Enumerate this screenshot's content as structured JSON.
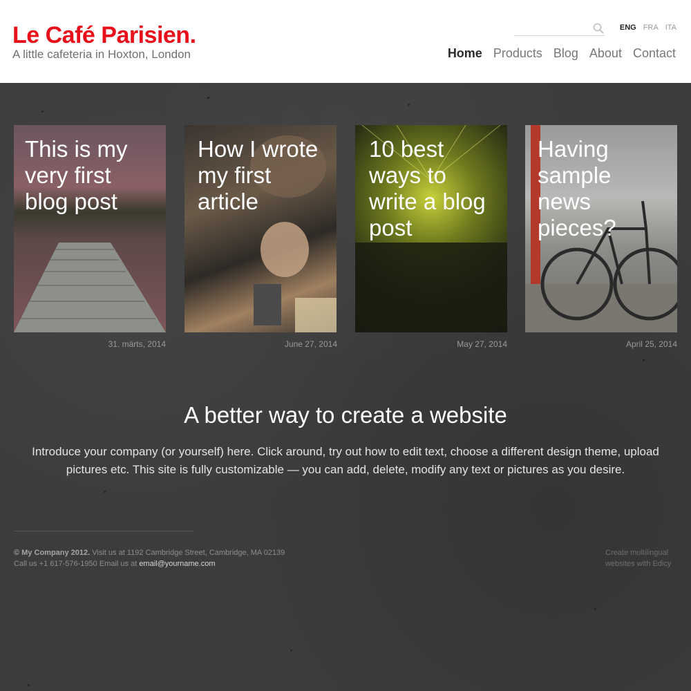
{
  "header": {
    "title": "Le Café Parisien.",
    "subtitle": "A little cafeteria in Hoxton, London",
    "search": {
      "placeholder": "",
      "value": ""
    },
    "languages": [
      {
        "label": "ENG",
        "active": true
      },
      {
        "label": "FRA",
        "active": false
      },
      {
        "label": "ITA",
        "active": false
      }
    ],
    "nav": [
      {
        "label": "Home",
        "active": true
      },
      {
        "label": "Products",
        "active": false
      },
      {
        "label": "Blog",
        "active": false
      },
      {
        "label": "About",
        "active": false
      },
      {
        "label": "Contact",
        "active": false
      }
    ]
  },
  "posts": [
    {
      "title": "This is my very first blog post",
      "date": "31. märts, 2014",
      "image": "lake-dock"
    },
    {
      "title": "How I wrote my first article",
      "date": "June 27, 2014",
      "image": "craftsman-tools"
    },
    {
      "title": "10 best ways to write a blog post",
      "date": "May 27, 2014",
      "image": "concert-crowd"
    },
    {
      "title": "Having sample news pieces?",
      "date": "April 25, 2014",
      "image": "bicycle"
    }
  ],
  "intro": {
    "title": "A better way to create a website",
    "text": "Introduce your company (or yourself) here. Click around, try out how to edit text, choose a different design theme, upload pictures etc. This site is fully customizable — you can add, delete, modify any text or pictures as you desire."
  },
  "footer": {
    "copyright": "© My Company 2012.",
    "address": " Visit us at 1192 Cambridge Street, Cambridge, MA 02139",
    "phone": "Call us +1 617-576-1950  Email us at ",
    "email": "email@yourname.com",
    "credit_line1": "Create multilingual",
    "credit_line2": "websites with Edicy"
  },
  "colors": {
    "brand": "#e8101a",
    "background": "#3c3c3c",
    "header_bg": "#ffffff"
  }
}
